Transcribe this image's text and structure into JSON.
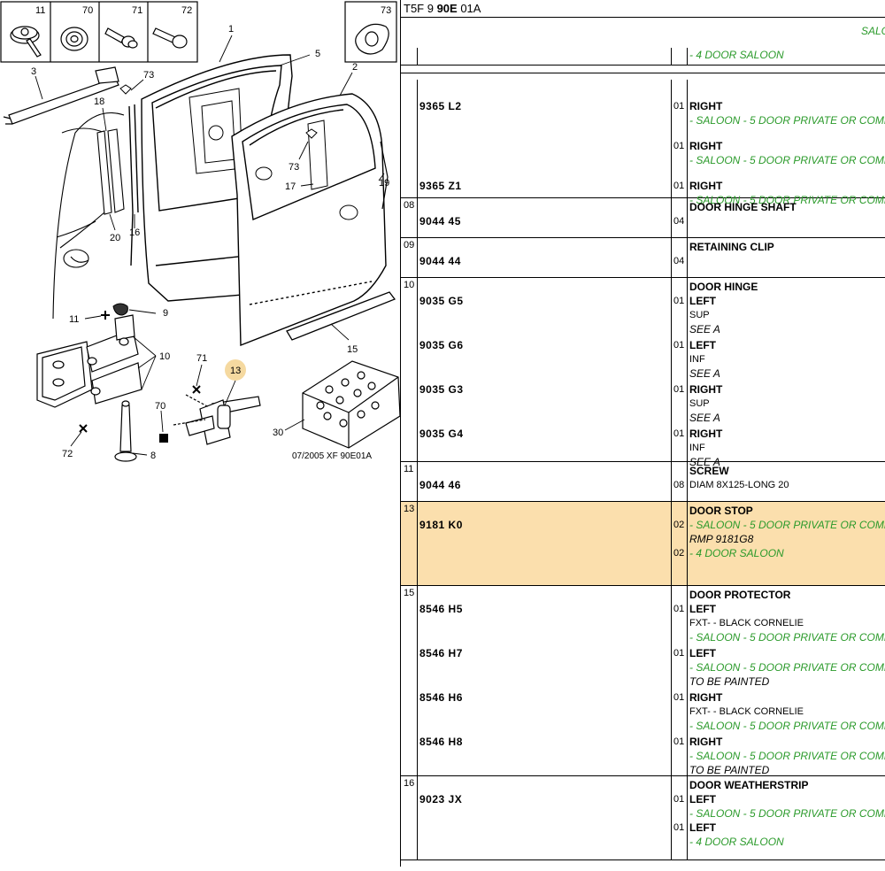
{
  "header": {
    "ref_prefix": "T5F 9 ",
    "ref_bold": "90E",
    "ref_suffix": " 01A"
  },
  "model_banner": "SALO",
  "diagram": {
    "fastener_labels": [
      "11",
      "70",
      "71",
      "72"
    ],
    "clip_label": "73",
    "callouts": [
      "1",
      "2",
      "3",
      "5",
      "8",
      "9",
      "10",
      "11",
      "13",
      "15",
      "16",
      "17",
      "18",
      "19",
      "20",
      "30",
      "70",
      "71",
      "72",
      "73",
      "73",
      "73"
    ],
    "footer": "07/2005   XF 90E01A",
    "highlight_color": "#f5d9a0"
  },
  "table": {
    "rows": [
      {
        "num": "",
        "lines": [
          {
            "ref": "",
            "qty": "",
            "desc": "- 4 DOOR SALOON",
            "style": "green"
          }
        ]
      },
      {
        "num": "",
        "lines": [
          {
            "ref": "9365 L2",
            "qty": "01",
            "desc": "RIGHT",
            "style": "bold"
          },
          {
            "ref": "",
            "qty": "",
            "desc": "- SALOON - 5 DOOR PRIVATE OR COMI",
            "style": "green"
          },
          {
            "ref": "",
            "qty": "01",
            "desc": "RIGHT",
            "style": "bold"
          },
          {
            "ref": "",
            "qty": "",
            "desc": "- SALOON - 5 DOOR PRIVATE OR COMI",
            "style": "green"
          },
          {
            "ref": "9365 Z1",
            "qty": "01",
            "desc": "RIGHT",
            "style": "bold"
          },
          {
            "ref": "",
            "qty": "",
            "desc": "- SALOON - 5 DOOR PRIVATE OR COMI",
            "style": "green"
          }
        ]
      },
      {
        "num": "08",
        "lines": [
          {
            "ref": "",
            "qty": "",
            "desc": "DOOR HINGE SHAFT",
            "style": "title"
          },
          {
            "ref": "9044 45",
            "qty": "04",
            "desc": "",
            "style": "plain"
          }
        ]
      },
      {
        "num": "09",
        "lines": [
          {
            "ref": "",
            "qty": "",
            "desc": "RETAINING CLIP",
            "style": "title"
          },
          {
            "ref": "9044 44",
            "qty": "04",
            "desc": "",
            "style": "plain"
          }
        ]
      },
      {
        "num": "10",
        "lines": [
          {
            "ref": "",
            "qty": "",
            "desc": "DOOR HINGE",
            "style": "title"
          },
          {
            "ref": "9035 G5",
            "qty": "01",
            "desc": "LEFT",
            "style": "bold"
          },
          {
            "ref": "",
            "qty": "",
            "desc": "SUP",
            "style": "plain"
          },
          {
            "ref": "",
            "qty": "",
            "desc": "SEE A",
            "style": "ital"
          },
          {
            "ref": "9035 G6",
            "qty": "01",
            "desc": "LEFT",
            "style": "bold"
          },
          {
            "ref": "",
            "qty": "",
            "desc": "INF",
            "style": "plain"
          },
          {
            "ref": "",
            "qty": "",
            "desc": "SEE A",
            "style": "ital"
          },
          {
            "ref": "9035 G3",
            "qty": "01",
            "desc": "RIGHT",
            "style": "bold"
          },
          {
            "ref": "",
            "qty": "",
            "desc": "SUP",
            "style": "plain"
          },
          {
            "ref": "",
            "qty": "",
            "desc": "SEE A",
            "style": "ital"
          },
          {
            "ref": "9035 G4",
            "qty": "01",
            "desc": "RIGHT",
            "style": "bold"
          },
          {
            "ref": "",
            "qty": "",
            "desc": "INF",
            "style": "plain"
          },
          {
            "ref": "",
            "qty": "",
            "desc": "SEE A",
            "style": "ital"
          }
        ]
      },
      {
        "num": "11",
        "lines": [
          {
            "ref": "",
            "qty": "",
            "desc": "SCREW",
            "style": "title"
          },
          {
            "ref": "9044 46",
            "qty": "08",
            "desc": "DIAM 8X125-LONG 20",
            "style": "plain"
          }
        ]
      },
      {
        "num": "13",
        "highlight": true,
        "extra": 2,
        "lines": [
          {
            "ref": "",
            "qty": "",
            "desc": "DOOR STOP",
            "style": "title"
          },
          {
            "ref": "9181 K0",
            "qty": "02",
            "desc": "- SALOON - 5 DOOR PRIVATE OR COMI",
            "style": "green"
          },
          {
            "ref": "",
            "qty": "",
            "desc": "RMP 9181G8",
            "style": "ital"
          },
          {
            "ref": "",
            "qty": "02",
            "desc": "- 4 DOOR SALOON",
            "style": "green"
          }
        ]
      },
      {
        "num": "15",
        "lines": [
          {
            "ref": "",
            "qty": "",
            "desc": "DOOR PROTECTOR",
            "style": "title"
          },
          {
            "ref": "8546 H5",
            "qty": "01",
            "desc": "LEFT",
            "style": "bold"
          },
          {
            "ref": "",
            "qty": "",
            "desc": "FXT- - BLACK CORNELIE",
            "style": "plain"
          },
          {
            "ref": "",
            "qty": "",
            "desc": "- SALOON - 5 DOOR PRIVATE OR COMI",
            "style": "green"
          },
          {
            "ref": "8546 H7",
            "qty": "01",
            "desc": "LEFT",
            "style": "bold"
          },
          {
            "ref": "",
            "qty": "",
            "desc": "- SALOON - 5 DOOR PRIVATE OR COMI",
            "style": "green"
          },
          {
            "ref": "",
            "qty": "",
            "desc": "TO BE PAINTED",
            "style": "ital"
          },
          {
            "ref": "8546 H6",
            "qty": "01",
            "desc": "RIGHT",
            "style": "bold"
          },
          {
            "ref": "",
            "qty": "",
            "desc": "FXT- - BLACK CORNELIE",
            "style": "plain"
          },
          {
            "ref": "",
            "qty": "",
            "desc": "- SALOON - 5 DOOR PRIVATE OR COMI",
            "style": "green"
          },
          {
            "ref": "8546 H8",
            "qty": "01",
            "desc": "RIGHT",
            "style": "bold"
          },
          {
            "ref": "",
            "qty": "",
            "desc": "- SALOON - 5 DOOR PRIVATE OR COMI",
            "style": "green"
          },
          {
            "ref": "",
            "qty": "",
            "desc": "TO BE PAINTED",
            "style": "ital"
          }
        ]
      },
      {
        "num": "16",
        "lines": [
          {
            "ref": "",
            "qty": "",
            "desc": "DOOR WEATHERSTRIP",
            "style": "title"
          },
          {
            "ref": "9023 JX",
            "qty": "01",
            "desc": "LEFT",
            "style": "bold"
          },
          {
            "ref": "",
            "qty": "",
            "desc": "- SALOON - 5 DOOR PRIVATE OR COMI",
            "style": "green"
          },
          {
            "ref": "",
            "qty": "01",
            "desc": "LEFT",
            "style": "bold"
          },
          {
            "ref": "",
            "qty": "",
            "desc": "- 4 DOOR SALOON",
            "style": "green"
          }
        ]
      }
    ]
  }
}
